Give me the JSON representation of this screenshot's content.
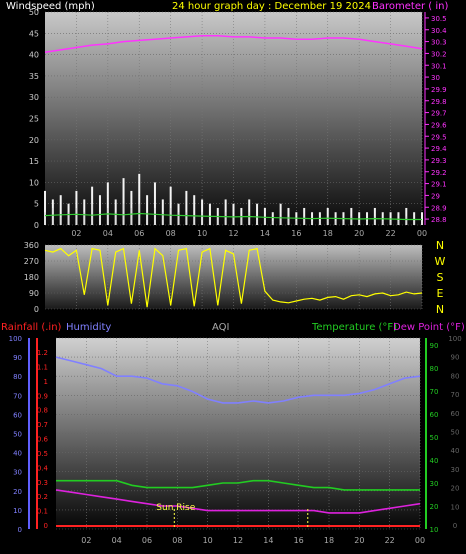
{
  "chart_data": [
    {
      "type": "line",
      "panel": "wind-barometer",
      "title": "24 hour graph day : December 19 2024",
      "left_axis_label": "Windspeed (mph)",
      "right_axis_label": "Barometer ( in)",
      "left_ticks": [
        "0",
        "5",
        "10",
        "15",
        "20",
        "25",
        "30",
        "35",
        "40",
        "45",
        "50"
      ],
      "right_ticks": [
        "28.8",
        "28.9",
        "29",
        "29.1",
        "29.2",
        "29.3",
        "29.4",
        "29.5",
        "29.6",
        "29.7",
        "29.8",
        "29.9",
        "30",
        "30.1",
        "30.2",
        "30.3",
        "30.4",
        "30.5"
      ],
      "x_ticks": [
        "02",
        "04",
        "06",
        "08",
        "10",
        "12",
        "14",
        "16",
        "18",
        "20",
        "22",
        "00"
      ],
      "ylim_left": [
        0,
        50
      ],
      "ylim_right": [
        28.75,
        30.55
      ],
      "x_range": [
        0,
        24
      ],
      "grid": true,
      "series": [
        {
          "color": "#ff33ff",
          "axis": "right",
          "x": [
            0,
            1,
            2,
            3,
            4,
            5,
            6,
            7,
            8,
            9,
            10,
            11,
            12,
            13,
            14,
            15,
            16,
            17,
            18,
            19,
            20,
            21,
            22,
            23,
            24
          ],
          "values": [
            30.21,
            30.23,
            30.25,
            30.27,
            30.28,
            30.3,
            30.31,
            30.32,
            30.33,
            30.34,
            30.35,
            30.35,
            30.34,
            30.34,
            30.33,
            30.33,
            30.32,
            30.32,
            30.33,
            30.33,
            30.32,
            30.3,
            30.28,
            30.26,
            30.24
          ]
        },
        {
          "color": "#ffffff",
          "axis": "left",
          "style": "gust-bars",
          "x": [
            0,
            0.5,
            1,
            1.5,
            2,
            2.5,
            3,
            3.5,
            4,
            4.5,
            5,
            5.5,
            6,
            6.5,
            7,
            7.5,
            8,
            8.5,
            9,
            9.5,
            10,
            10.5,
            11,
            11.5,
            12,
            12.5,
            13,
            13.5,
            14,
            14.5,
            15,
            15.5,
            16,
            16.5,
            17,
            17.5,
            18,
            18.5,
            19,
            19.5,
            20,
            20.5,
            21,
            21.5,
            22,
            22.5,
            23,
            23.5,
            24
          ],
          "values": [
            8,
            6,
            7,
            5,
            8,
            6,
            9,
            7,
            10,
            6,
            11,
            8,
            12,
            7,
            10,
            6,
            9,
            5,
            8,
            7,
            6,
            5,
            4,
            6,
            5,
            4,
            6,
            5,
            4,
            3,
            5,
            4,
            3,
            4,
            3,
            3,
            4,
            3,
            3,
            4,
            3,
            3,
            4,
            3,
            3,
            3,
            4,
            3,
            3
          ]
        },
        {
          "color": "#d8d8d8",
          "axis": "left",
          "style": "wind-bars",
          "x": [
            0,
            0.5,
            1,
            1.5,
            2,
            2.5,
            3,
            3.5,
            4,
            4.5,
            5,
            5.5,
            6,
            6.5,
            7,
            7.5,
            8,
            8.5,
            9,
            9.5,
            10,
            10.5,
            11,
            11.5,
            12,
            12.5,
            13,
            13.5,
            14,
            14.5,
            15,
            15.5,
            16,
            16.5,
            17,
            17.5,
            18,
            18.5,
            19,
            19.5,
            20,
            20.5,
            21,
            21.5,
            22,
            22.5,
            23,
            23.5,
            24
          ],
          "values": [
            3,
            4,
            2,
            3,
            4,
            3,
            5,
            3,
            4,
            3,
            5,
            4,
            5,
            3,
            4,
            3,
            4,
            3,
            3,
            2,
            3,
            2,
            2,
            3,
            2,
            2,
            3,
            2,
            2,
            1,
            2,
            2,
            1,
            2,
            1,
            1,
            2,
            1,
            1,
            2,
            1,
            1,
            2,
            1,
            1,
            1,
            2,
            1,
            1
          ]
        },
        {
          "color": "#33cc33",
          "axis": "left",
          "style": "line",
          "x": [
            0,
            1,
            2,
            3,
            4,
            5,
            6,
            7,
            8,
            9,
            10,
            11,
            12,
            13,
            14,
            15,
            16,
            17,
            18,
            19,
            20,
            21,
            22,
            23,
            24
          ],
          "values": [
            2.2,
            2.4,
            2.5,
            2.3,
            2.6,
            2.4,
            2.7,
            2.5,
            2.3,
            2.2,
            2.1,
            2.0,
            1.9,
            2.0,
            1.8,
            1.7,
            1.6,
            1.5,
            1.6,
            1.5,
            1.4,
            1.5,
            1.4,
            1.3,
            1.3
          ]
        }
      ]
    },
    {
      "type": "line",
      "panel": "wind-direction",
      "left_ticks": [
        "0",
        "90",
        "180",
        "270",
        "360"
      ],
      "right_labels": [
        "N",
        "W",
        "S",
        "E",
        "N"
      ],
      "ylim": [
        0,
        360
      ],
      "x_range": [
        0,
        24
      ],
      "grid": true,
      "series": [
        {
          "color": "#ffff00",
          "style": "direction-spikes",
          "x": [
            0,
            0.5,
            1,
            1.5,
            2,
            2.5,
            3,
            3.5,
            4,
            4.5,
            5,
            5.5,
            6,
            6.5,
            7,
            7.5,
            8,
            8.5,
            9,
            9.5,
            10,
            10.5,
            11,
            11.5,
            12,
            12.5,
            13,
            13.5,
            14,
            14.5,
            15,
            15.5,
            16,
            16.5,
            17,
            17.5,
            18,
            18.5,
            19,
            19.5,
            20,
            20.5,
            21,
            21.5,
            22,
            22.5,
            23,
            23.5,
            24
          ],
          "values": [
            330,
            320,
            340,
            300,
            330,
            80,
            340,
            330,
            20,
            320,
            340,
            30,
            330,
            10,
            340,
            300,
            20,
            330,
            340,
            15,
            320,
            340,
            20,
            330,
            310,
            30,
            330,
            340,
            100,
            50,
            40,
            35,
            45,
            55,
            60,
            50,
            65,
            70,
            55,
            75,
            80,
            70,
            85,
            90,
            75,
            80,
            95,
            85,
            90
          ]
        }
      ]
    },
    {
      "type": "line",
      "panel": "rain-humidity-temperature",
      "labels": {
        "rainfall": "Rainfall (.in)",
        "humidity": "Humidity",
        "aqi": "AQI",
        "temperature": "Temperature (°F)",
        "dew_point": "Dew Point (°F)",
        "sun_rise": "Sun Rise"
      },
      "humidity_ticks": [
        "0",
        "10",
        "20",
        "30",
        "40",
        "50",
        "60",
        "70",
        "80",
        "90",
        "100"
      ],
      "rain_ticks": [
        "0",
        "0.1",
        "0.2",
        "0.3",
        "0.4",
        "0.5",
        "0.6",
        "0.7",
        "0.8",
        "0.9",
        "1",
        "1.1",
        "1.2"
      ],
      "temp_ticks": [
        "10",
        "20",
        "30",
        "40",
        "50",
        "60",
        "70",
        "80",
        "90"
      ],
      "aqi_ticks": [
        "0",
        "10",
        "20",
        "30",
        "40",
        "50",
        "60",
        "70",
        "80",
        "90",
        "100"
      ],
      "x_ticks": [
        "02",
        "04",
        "06",
        "08",
        "10",
        "12",
        "14",
        "16",
        "18",
        "20",
        "22",
        "00"
      ],
      "ylim_humidity": [
        0,
        100
      ],
      "ylim_temp": [
        10,
        93
      ],
      "x_range": [
        0,
        24
      ],
      "sun_rise_hour": 7.8,
      "sun_set_hour": 16.6,
      "grid": true,
      "series": [
        {
          "name": "Humidity",
          "color": "#8080ff",
          "axis": "humidity",
          "x": [
            0,
            1,
            2,
            3,
            4,
            5,
            6,
            7,
            8,
            9,
            10,
            11,
            12,
            13,
            14,
            15,
            16,
            17,
            18,
            19,
            20,
            21,
            22,
            23,
            24
          ],
          "values": [
            90,
            88,
            86,
            84,
            80,
            80,
            79,
            76,
            75,
            72,
            68,
            66,
            66,
            67,
            66,
            67,
            69,
            70,
            70,
            70,
            71,
            73,
            76,
            79,
            80
          ]
        },
        {
          "name": "Temperature",
          "color": "#22cc22",
          "axis": "temp",
          "x": [
            0,
            1,
            2,
            3,
            4,
            5,
            6,
            7,
            8,
            9,
            10,
            11,
            12,
            13,
            14,
            15,
            16,
            17,
            18,
            19,
            20,
            21,
            22,
            23,
            24
          ],
          "values": [
            31,
            31,
            31,
            31,
            31,
            29,
            28,
            28,
            28,
            28,
            29,
            30,
            30,
            31,
            31,
            30,
            29,
            28,
            28,
            27,
            27,
            27,
            27,
            27,
            27
          ]
        },
        {
          "name": "Dew Point",
          "color": "#dd22dd",
          "axis": "temp",
          "x": [
            0,
            1,
            2,
            3,
            4,
            5,
            6,
            7,
            8,
            9,
            10,
            11,
            12,
            13,
            14,
            15,
            16,
            17,
            18,
            19,
            20,
            21,
            22,
            23,
            24
          ],
          "values": [
            27,
            26,
            25,
            24,
            23,
            22,
            21,
            20,
            20,
            19,
            18,
            18,
            18,
            18,
            18,
            18,
            18,
            18,
            17,
            17,
            17,
            18,
            19,
            20,
            21
          ]
        },
        {
          "name": "Rainfall",
          "color": "#ff2222",
          "axis": "rain",
          "x": [
            0,
            24
          ],
          "values": [
            0,
            0
          ]
        }
      ]
    }
  ]
}
